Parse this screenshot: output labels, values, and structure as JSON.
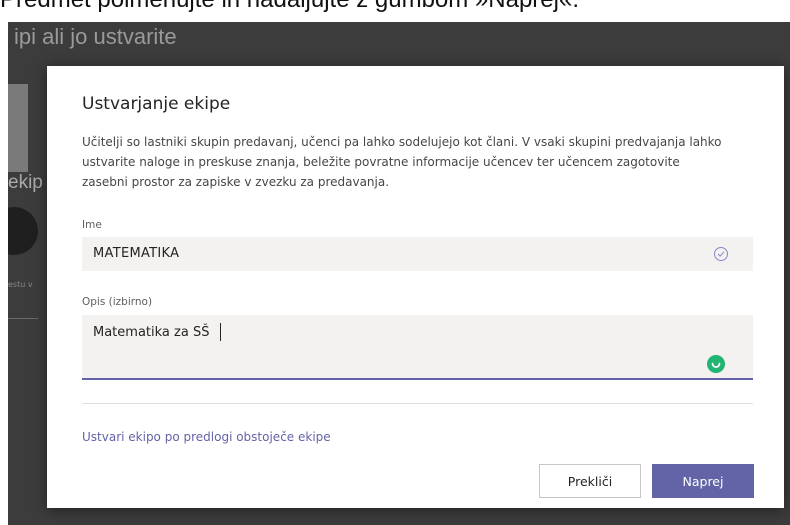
{
  "document": {
    "caption": "Predmet poimenujte in nadaljujte z gumbom »Naprej«."
  },
  "background": {
    "heading": "ipi ali jo ustvarite",
    "side_label": "ekip",
    "tiny_text": "estu v"
  },
  "dialog": {
    "title": "Ustvarjanje ekipe",
    "description": "Učitelji so lastniki skupin predavanj, učenci pa lahko sodelujejo kot člani. V vsaki skupini predvajanja lahko ustvarite naloge in preskuse znanja, beležite povratne informacije učencev ter učencem zagotovite zasebni prostor za zapiske v zvezku za predavanja.",
    "name_field": {
      "label": "Ime",
      "value": "MATEMATIKA",
      "icon": "check-circle-icon"
    },
    "description_field": {
      "label": "Opis (izbirno)",
      "value": "Matematika za SŠ",
      "icon": "grammarly-icon"
    },
    "template_link": "Ustvari ekipo po predlogi obstoječe ekipe",
    "cancel_button": "Prekliči",
    "next_button": "Naprej"
  },
  "colors": {
    "accent": "#6264a7",
    "grammar_green": "#21b573",
    "overlay": "#3c3c3c"
  }
}
